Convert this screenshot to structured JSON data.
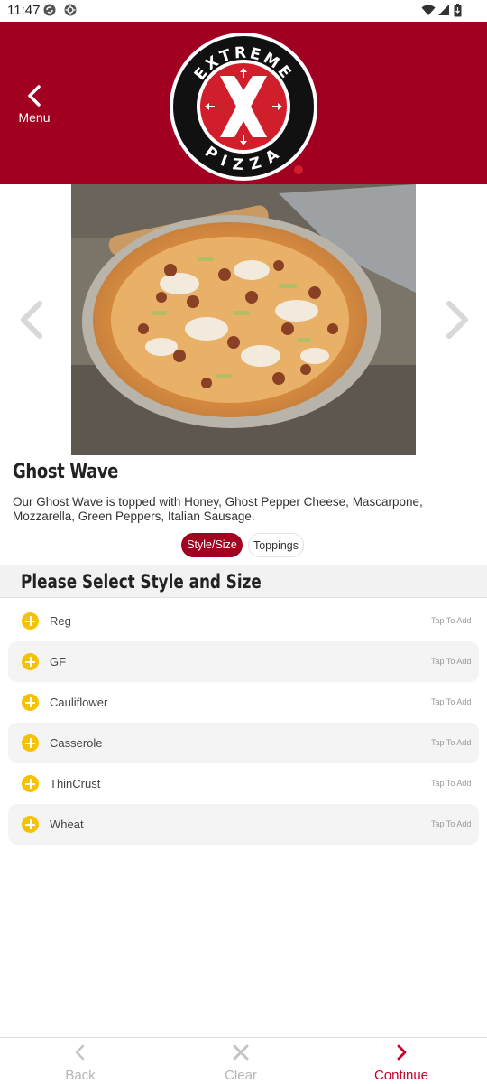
{
  "status_bar": {
    "time": "11:47"
  },
  "header": {
    "menu_label": "Menu",
    "logo_text_top": "EXTREME",
    "logo_text_bottom": "PIZZA",
    "brand_color": "#a10021"
  },
  "product": {
    "name": "Ghost Wave",
    "description": "Our Ghost Wave  is topped with Honey, Ghost Pepper Cheese, Mascarpone, Mozzarella, Green Peppers, Italian Sausage."
  },
  "tabs": [
    {
      "label": "Style/Size",
      "active": true
    },
    {
      "label": "Toppings",
      "active": false
    }
  ],
  "section": {
    "title": "Please Select Style and Size"
  },
  "options": [
    {
      "name": "Reg",
      "hint": "Tap To Add"
    },
    {
      "name": "GF",
      "hint": "Tap To Add"
    },
    {
      "name": "Cauliflower",
      "hint": "Tap To Add"
    },
    {
      "name": "Casserole",
      "hint": "Tap To Add"
    },
    {
      "name": "ThinCrust",
      "hint": "Tap To Add"
    },
    {
      "name": "Wheat",
      "hint": "Tap To Add"
    }
  ],
  "bottom_bar": {
    "back_label": "Back",
    "clear_label": "Clear",
    "continue_label": "Continue",
    "accent_color": "#c8002a",
    "icons": [
      "chevron-left-icon",
      "close-icon",
      "chevron-right-icon"
    ]
  }
}
